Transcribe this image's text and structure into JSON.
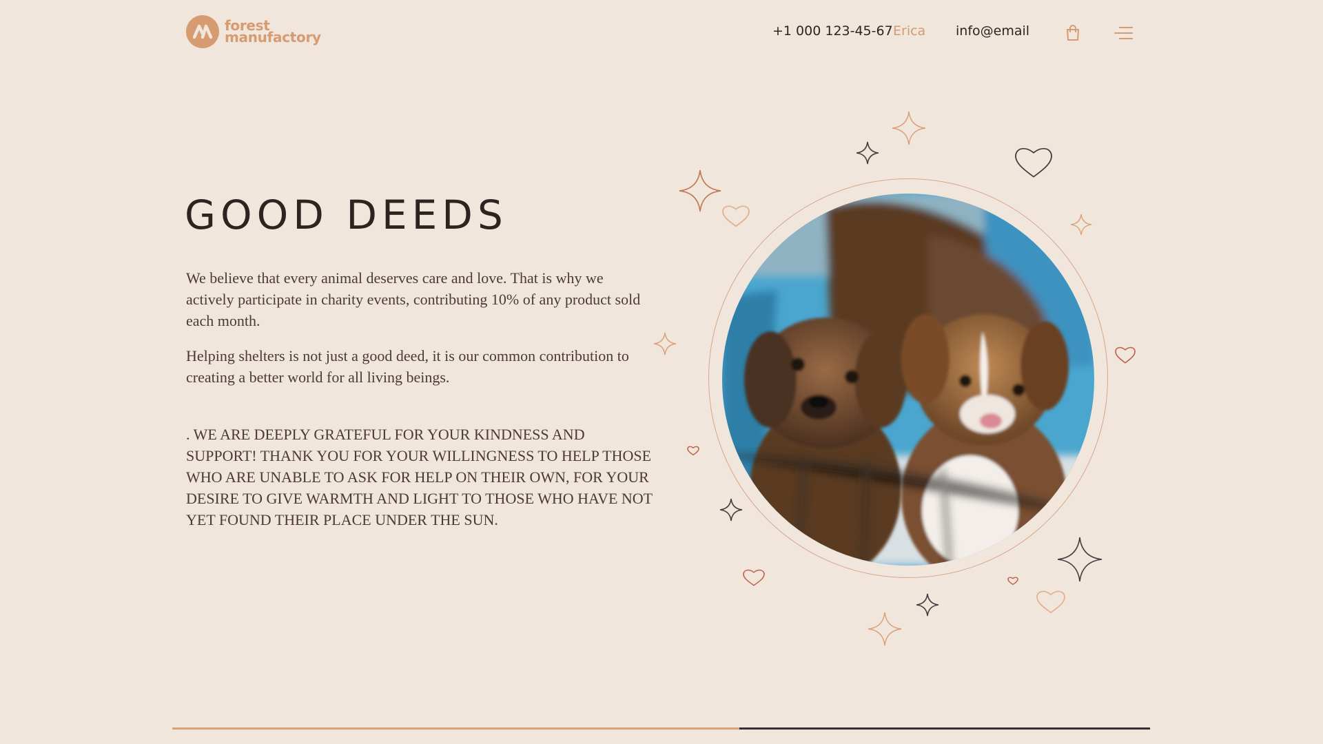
{
  "header": {
    "logo_line1": "forest",
    "logo_line2": "manufactory",
    "phone": "+1 000 123-45-67",
    "user": "Erica",
    "email": "info@email"
  },
  "hero": {
    "title": "GOOD DEEDS",
    "paragraph1": "We believe that every animal deserves care and love. That is why we actively participate in charity events, contributing 10% of any product sold each month.",
    "paragraph2": "Helping shelters is not just a good deed, it is our common contribution to creating a better world for all living beings.",
    "gratitude": ". WE ARE DEEPLY GRATEFUL FOR YOUR KINDNESS AND SUPPORT! THANK YOU FOR YOUR WILLINGNESS TO HELP THOSE WHO ARE UNABLE TO ASK FOR HELP ON THEIR OWN, FOR YOUR DESIRE TO GIVE WARMTH AND LIGHT TO THOSE WHO HAVE NOT YET FOUND THEIR PLACE UNDER THE SUN."
  },
  "progress": {
    "fraction": 0.58
  },
  "colors": {
    "background": "#f1e6dc",
    "accent": "#d79b72",
    "text": "#2e2320",
    "progress_track": "#3a2d3a"
  },
  "icons": {
    "logo": "logo-mark-icon",
    "cart": "shopping-bag-icon",
    "menu": "hamburger-menu-icon",
    "decor": [
      "sparkle-icon",
      "heart-icon"
    ]
  }
}
